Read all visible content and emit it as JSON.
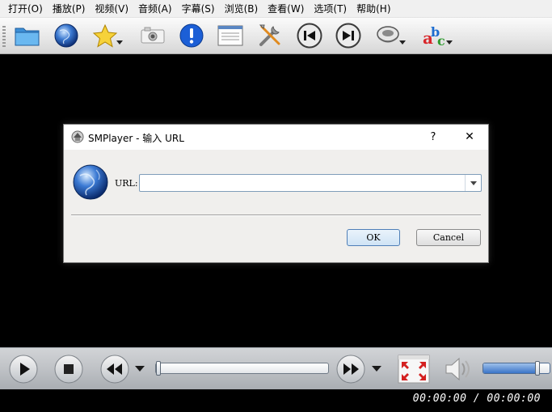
{
  "menubar": {
    "items": [
      "打开(O)",
      "播放(P)",
      "视频(V)",
      "音频(A)",
      "字幕(S)",
      "浏览(B)",
      "查看(W)",
      "选项(T)",
      "帮助(H)"
    ]
  },
  "toolbar": {
    "buttons": [
      "open-folder-icon",
      "globe-icon",
      "favorites-star-icon",
      "screenshot-camera-icon",
      "info-icon",
      "playlist-icon",
      "preferences-tools-icon",
      "previous-icon",
      "next-icon",
      "audio-icon",
      "subtitles-icon"
    ]
  },
  "dialog": {
    "title": "SMPlayer - 输入 URL",
    "help": "?",
    "close": "✕",
    "url_label": "URL:",
    "url_value": "",
    "ok_label": "OK",
    "cancel_label": "Cancel"
  },
  "controlbar": {
    "seek_position": 0.0,
    "volume_level": 0.83
  },
  "status": {
    "time": "00:00:00 / 00:00:00"
  },
  "colors": {
    "video_bg": "#000000",
    "accent": "#3a74c8"
  }
}
